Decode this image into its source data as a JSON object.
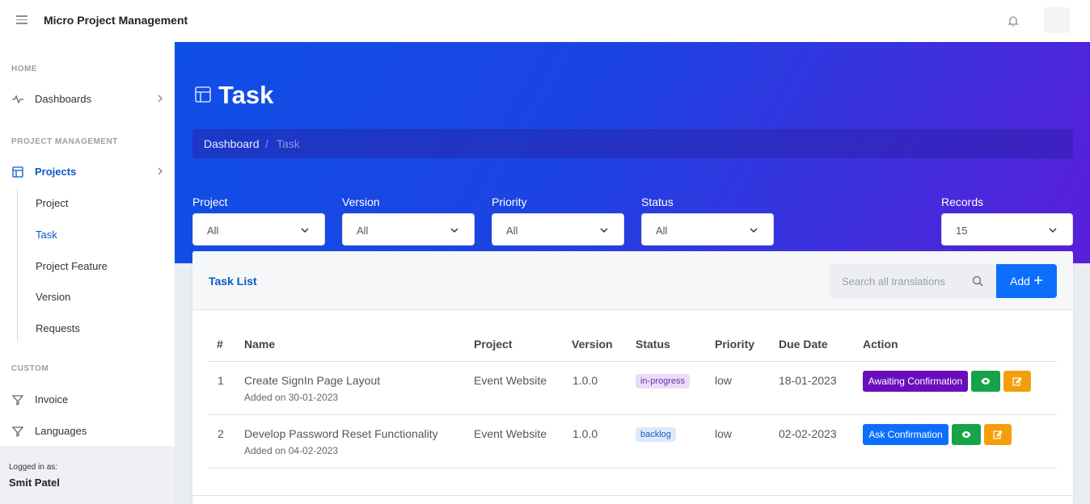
{
  "app": {
    "title": "Micro Project Management"
  },
  "sidebar": {
    "sections": [
      {
        "heading": "HOME"
      },
      {
        "heading": "PROJECT MANAGEMENT"
      },
      {
        "heading": "CUSTOM"
      }
    ],
    "items": [
      {
        "label": "Dashboards",
        "icon": "activity-icon"
      },
      {
        "label": "Projects",
        "icon": "layout-icon"
      },
      {
        "label": "Invoice",
        "icon": "filter-icon"
      },
      {
        "label": "Languages",
        "icon": "filter-icon"
      }
    ],
    "subitems": [
      "Project",
      "Task",
      "Project Feature",
      "Version",
      "Requests"
    ],
    "active_subitem": "Task",
    "footer": {
      "label": "Logged in as:",
      "user": "Smit Patel"
    }
  },
  "header": {
    "title": "Task",
    "breadcrumb": {
      "root": "Dashboard",
      "separator": "/",
      "current": "Task"
    }
  },
  "filters": [
    {
      "label": "Project",
      "value": "All"
    },
    {
      "label": "Version",
      "value": "All"
    },
    {
      "label": "Priority",
      "value": "All"
    },
    {
      "label": "Status",
      "value": "All"
    },
    {
      "label": "Records",
      "value": "15"
    }
  ],
  "card": {
    "title": "Task List",
    "search_placeholder": "Search all translations",
    "add_label": "Add"
  },
  "table": {
    "columns": [
      "#",
      "Name",
      "Project",
      "Version",
      "Status",
      "Priority",
      "Due Date",
      "Action"
    ],
    "rows": [
      {
        "num": "1",
        "name": "Create SignIn Page Layout",
        "added": "Added on 30-01-2023",
        "project": "Event Website",
        "version": "1.0.0",
        "status": "in-progress",
        "priority": "low",
        "due": "18-01-2023",
        "action": "Awaiting Confirmation"
      },
      {
        "num": "2",
        "name": "Develop Password Reset Functionality",
        "added": "Added on 04-02-2023",
        "project": "Event Website",
        "version": "1.0.0",
        "status": "backlog",
        "priority": "low",
        "due": "02-02-2023",
        "action": "Ask Confirmation"
      }
    ]
  },
  "colors": {
    "accent": "#0d6efd",
    "gradient_start": "#0f4fe6",
    "gradient_end": "#5a1ed8",
    "await_btn": "#6a0dbd",
    "view_btn": "#16a34a",
    "edit_btn": "#f59e0b"
  }
}
